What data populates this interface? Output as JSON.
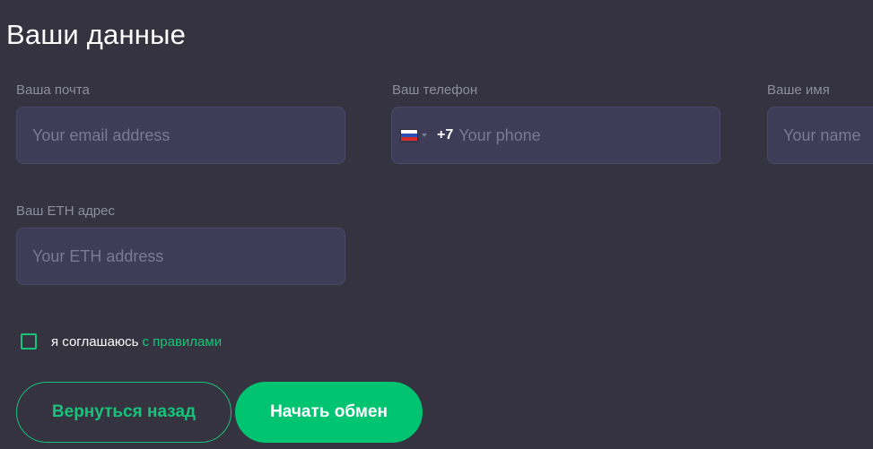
{
  "form": {
    "title": "Ваши данные",
    "email": {
      "label": "Ваша почта",
      "placeholder": "Your email address",
      "value": ""
    },
    "phone": {
      "label": "Ваш телефон",
      "placeholder": "Your phone",
      "value": "",
      "country_flag": "russia-flag-icon",
      "dial_code": "+7"
    },
    "name": {
      "label": "Ваше имя",
      "placeholder": "Your name",
      "value": ""
    },
    "eth": {
      "label": "Ваш ETH адрес",
      "placeholder": "Your ETH address",
      "value": ""
    },
    "agreement": {
      "checked": false,
      "text": "я соглашаюсь",
      "link_text": "с правилами"
    },
    "buttons": {
      "back_label": "Вернуться назад",
      "start_label": "Начать обмен"
    }
  },
  "colors": {
    "background": "#34333f",
    "input_background": "#3e3c57",
    "accent": "#00c472",
    "label": "#8e8d9e",
    "placeholder": "#7b7a92"
  }
}
